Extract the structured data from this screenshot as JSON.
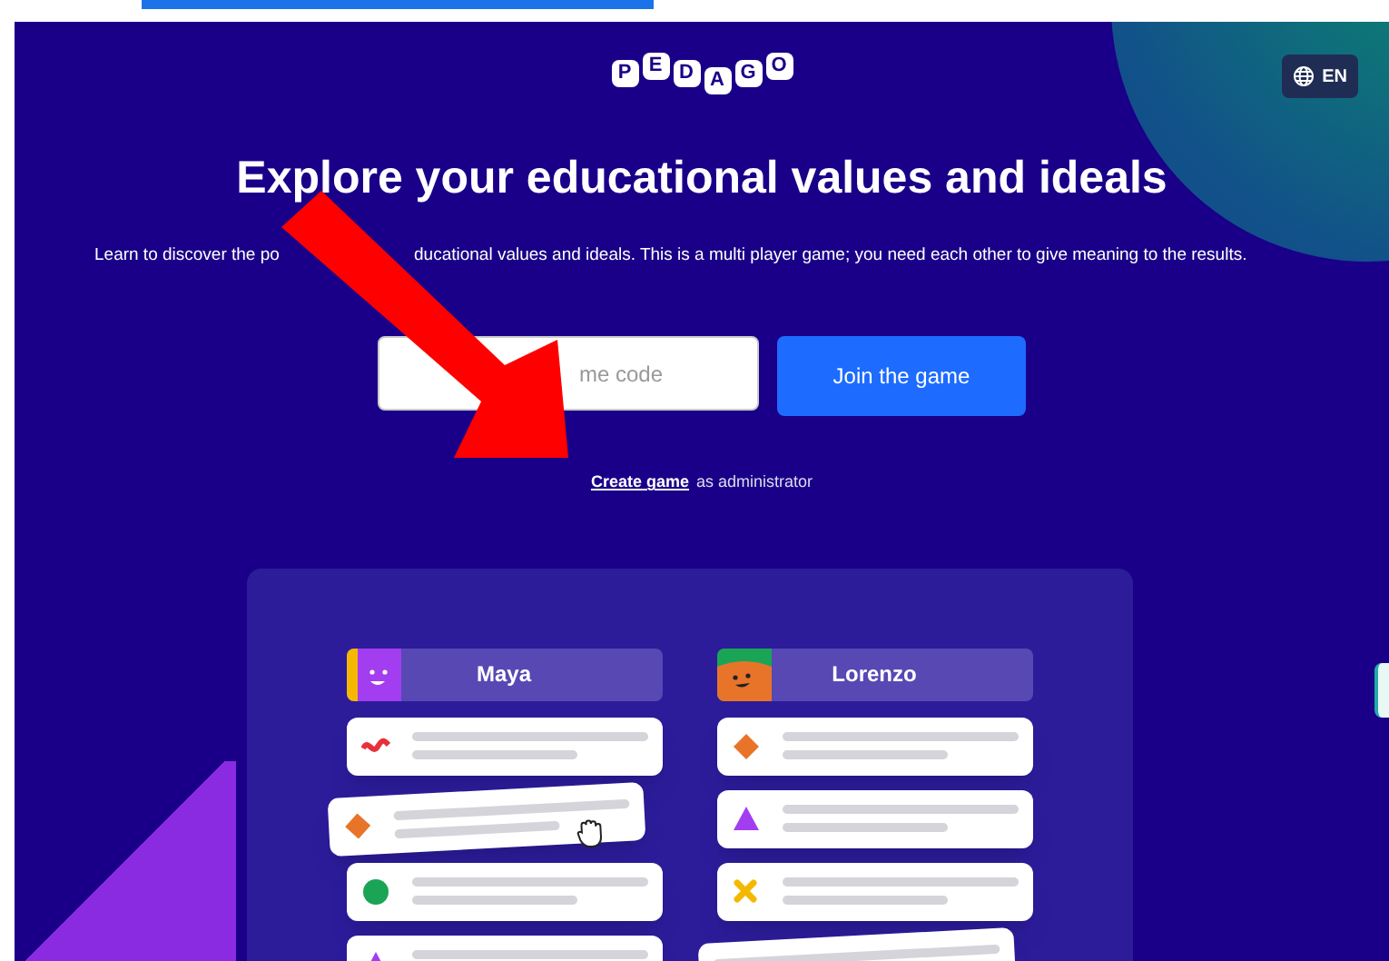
{
  "logo": {
    "letters": [
      "P",
      "E",
      "D",
      "A",
      "G",
      "O"
    ]
  },
  "language_button": {
    "label": "EN"
  },
  "title": "Explore your educational values and ideals",
  "subtitle": {
    "before": "Learn to discover the po",
    "after": "ducational values and ideals. This is a multi player game; you need each other to give meaning to the results."
  },
  "game_code_field": {
    "placeholder": "me code"
  },
  "join_button": "Join the game",
  "create_line": {
    "link": "Create game",
    "rest": "as administrator"
  },
  "players": [
    {
      "name": "Maya",
      "cards": [
        {
          "kind": "wave",
          "color": "#e8303c",
          "tilted": false
        },
        {
          "kind": "diamond",
          "color": "#e8742a",
          "tilted": true
        },
        {
          "kind": "circle",
          "color": "#1aa556",
          "tilted": false
        },
        {
          "kind": "triangle",
          "color": "#a23ef0",
          "tilted": false
        }
      ]
    },
    {
      "name": "Lorenzo",
      "cards": [
        {
          "kind": "diamond",
          "color": "#e8742a",
          "tilted": false
        },
        {
          "kind": "triangle",
          "color": "#a23ef0",
          "tilted": false
        },
        {
          "kind": "cross",
          "color": "#f5b800",
          "tilted": false
        },
        {
          "kind": "blank",
          "tilted": true
        }
      ]
    }
  ]
}
